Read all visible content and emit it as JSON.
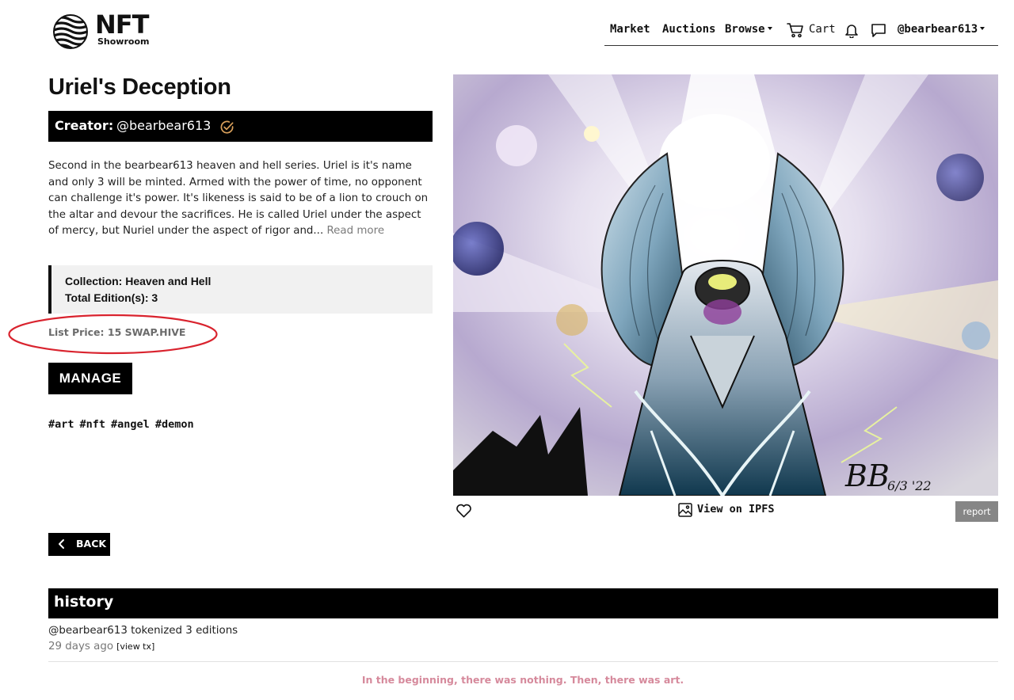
{
  "brand": {
    "logo_main": "NFT",
    "logo_sub": "Showroom"
  },
  "nav": {
    "market": "Market",
    "auctions": "Auctions",
    "browse": "Browse",
    "cart": "Cart",
    "user": "@bearbear613"
  },
  "nft": {
    "title": "Uriel's Deception",
    "creator_label": "Creator:",
    "creator": "@bearbear613",
    "description": "Second in the bearbear613 heaven and hell series. Uriel is it's name and only 3 will be minted. Armed with the power of time, no opponent can challenge it's power. It's likeness is said to be of a lion to crouch on the altar and devour the sacrifices. He is called Uriel under the aspect of mercy, but Nuriel under the aspect of rigor and...",
    "read_more": "Read more",
    "collection": "Collection: Heaven and Hell",
    "editions": "Total Edition(s): 3",
    "list_price": "List Price: 15 SWAP.HIVE",
    "manage": "MANAGE",
    "tags": [
      "#art",
      "#nft",
      "#angel",
      "#demon"
    ],
    "artwork_signature": "BB",
    "artwork_date": "6/3 '22"
  },
  "artwork_actions": {
    "view_ipfs": "View on IPFS",
    "report": "report"
  },
  "back": "BACK",
  "history": {
    "title": "history",
    "event": "@bearbear613 tokenized 3 editions",
    "time": "29 days ago",
    "view_tx": "[view tx]"
  },
  "footer": "In the beginning, there was nothing. Then, there was art.",
  "colors": {
    "accent_circle": "#d9232e",
    "footer_text": "#d68a9c",
    "verified_badge": "#d9a05b",
    "report_button": "#868686"
  }
}
